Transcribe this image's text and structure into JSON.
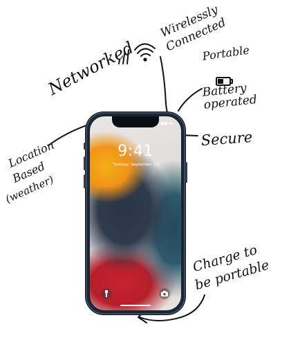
{
  "labels": {
    "networked": "Networked",
    "wireless_1": "Wirelessly",
    "wireless_2": "Connected",
    "portable": "Portable",
    "battery_1": "Battery",
    "battery_2": "operated",
    "secure": "Secure",
    "location_1": "Location",
    "location_2": "Based",
    "location_3": "(weather)",
    "charge_1": "Charge to",
    "charge_2": "be portable"
  },
  "phone": {
    "time": "9:41",
    "date": "Tuesday, September 14"
  },
  "colors": {
    "ink": "#111111",
    "frame": "#1b2634",
    "wallpaper_orange": "#f09418",
    "wallpaper_red": "#c8232e",
    "wallpaper_dark": "#2f3b4c",
    "wallpaper_teal": "#2d5a6c"
  },
  "icons": [
    "signal-bars-icon",
    "wifi-icon",
    "battery-icon",
    "flashlight-icon",
    "camera-icon"
  ]
}
